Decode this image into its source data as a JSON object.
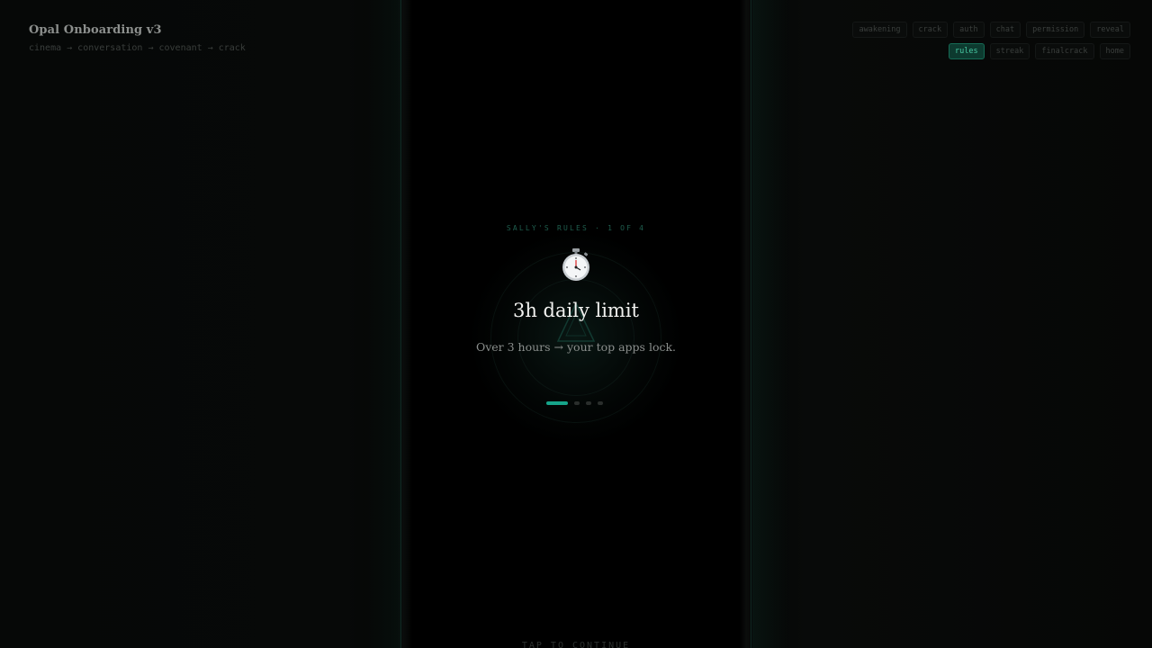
{
  "brand": {
    "title": "Opal Onboarding v3",
    "subtitle": "cinema → conversation → covenant → crack"
  },
  "nav": {
    "items": [
      {
        "label": "awakening",
        "active": false
      },
      {
        "label": "crack",
        "active": false
      },
      {
        "label": "auth",
        "active": false
      },
      {
        "label": "chat",
        "active": false
      },
      {
        "label": "permission",
        "active": false
      },
      {
        "label": "reveal",
        "active": false
      },
      {
        "label": "rules",
        "active": true
      },
      {
        "label": "streak",
        "active": false
      },
      {
        "label": "finalcrack",
        "active": false
      },
      {
        "label": "home",
        "active": false
      }
    ]
  },
  "rules": {
    "eyebrow": "SALLY'S RULES · 1 OF 4",
    "icon": "stopwatch-icon",
    "title": "3h daily limit",
    "body": "Over 3 hours → your top apps lock.",
    "current": 1,
    "total": 4
  },
  "footer": {
    "cta": "TAP TO CONTINUE"
  },
  "colors": {
    "accent": "#16a58a",
    "accent_pill_bg": "#0d3a2f",
    "background": "#000000"
  }
}
